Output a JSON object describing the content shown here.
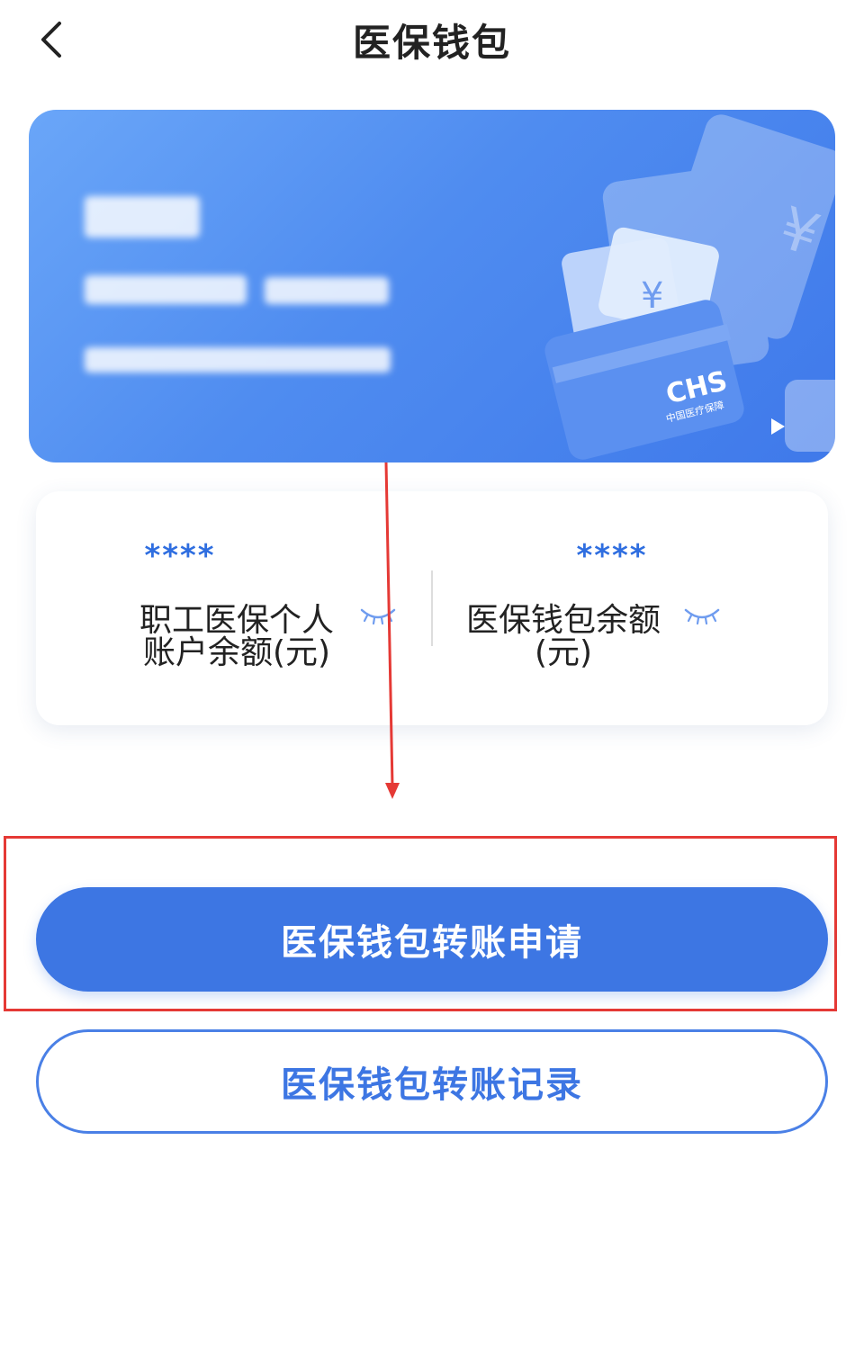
{
  "header": {
    "title": "医保钱包"
  },
  "card": {
    "logo_text": "CHS",
    "logo_subtext": "中国医疗保障"
  },
  "balance": {
    "personal_account": {
      "value": "****",
      "label_line1": "职工医保个人",
      "label_line2": "账户余额(元)"
    },
    "wallet": {
      "value": "****",
      "label_line1": "医保钱包余额",
      "label_line2": "(元)"
    }
  },
  "buttons": {
    "transfer_apply": "医保钱包转账申请",
    "transfer_records": "医保钱包转账记录"
  },
  "colors": {
    "primary": "#3d76e3",
    "annotation": "#e53935"
  }
}
